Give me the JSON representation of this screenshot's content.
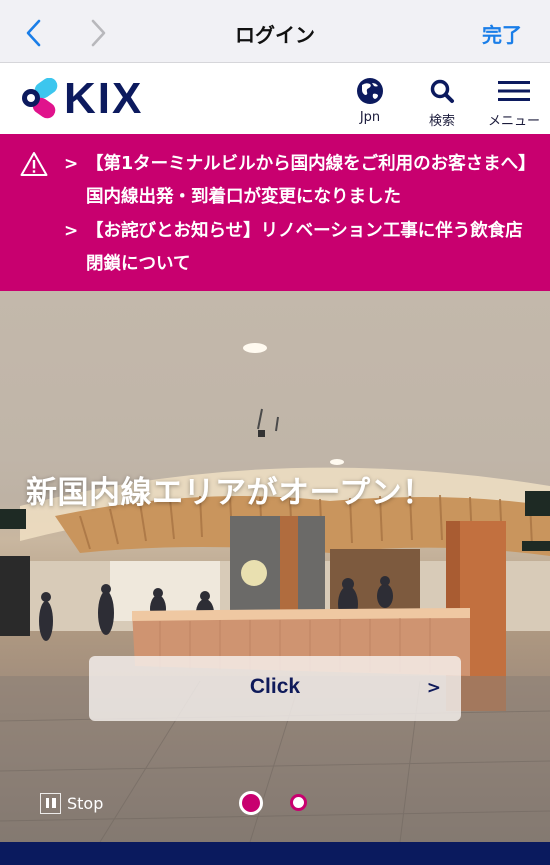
{
  "browser": {
    "title": "ログイン",
    "done_label": "完了",
    "back_icon": "chevron-left-icon",
    "forward_icon": "chevron-right-icon",
    "colors": {
      "accent": "#1a7ee8",
      "disabled": "#b8b8bc"
    }
  },
  "header": {
    "logo_text": "KIX",
    "buttons": [
      {
        "icon": "globe-icon",
        "label": "Jpn"
      },
      {
        "icon": "search-icon",
        "label": "検索"
      },
      {
        "icon": "menu-icon",
        "label": "メニュー"
      }
    ],
    "colors": {
      "brand_navy": "#0c1a5e",
      "brand_cyan": "#3cc6ee",
      "brand_magenta": "#e0138c"
    }
  },
  "alerts": {
    "icon": "warning-icon",
    "background": "#c8006f",
    "items": [
      {
        "text": "【第1ターミナルビルから国内線をご利用のお客さまへ】国内線出発・到着口が変更になりました"
      },
      {
        "text": "【お詫びとお知らせ】リノベーション工事に伴う飲食店閉鎖について"
      }
    ],
    "chevron": ">"
  },
  "hero": {
    "headline": "新国内線エリアがオープン！",
    "cta_label": "Click",
    "cta_chevron": ">",
    "stop_label": "Stop",
    "slides_total": 2,
    "active_slide": 1,
    "image_description": "Renovated domestic terminal food court with curved wooden counter and ceiling slats"
  }
}
